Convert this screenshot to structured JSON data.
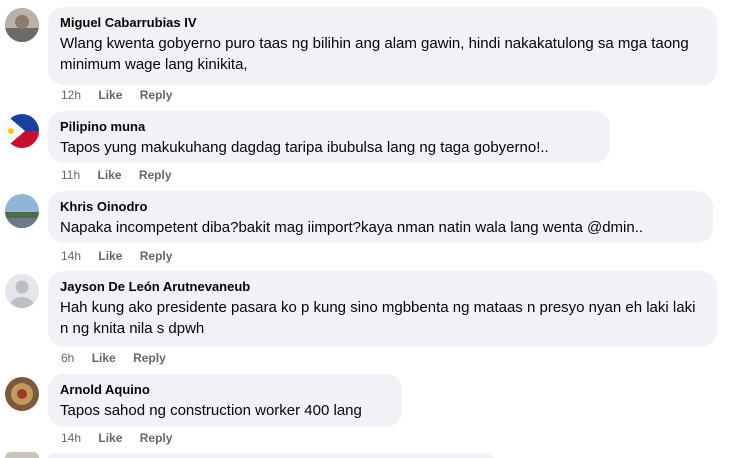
{
  "comments": [
    {
      "author": "Miguel Cabarrubias IV",
      "text": "Wlang kwenta gobyerno puro taas ng bilihin ang alam gawin, hindi nakakatulong sa mga taong minimum wage lang kinikita,",
      "time": "12h",
      "like_label": "Like",
      "reply_label": "Reply"
    },
    {
      "author": "Pilipino muna",
      "text": "Tapos yung makukuhang dagdag taripa ibubulsa lang ng taga gobyerno!..",
      "time": "11h",
      "like_label": "Like",
      "reply_label": "Reply"
    },
    {
      "author": "Khris Oinodro",
      "text": "Napaka incompetent diba?bakit mag iimport?kaya nman natin wala lang wenta @dmin..",
      "time": "14h",
      "like_label": "Like",
      "reply_label": "Reply"
    },
    {
      "author": "Jayson De León Arutnevaneub",
      "text": "Hah kung ako presidente pasara ko p kung sino mgbbenta ng mataas n presyo nyan eh laki laki n ng knita nila s dpwh",
      "time": "6h",
      "like_label": "Like",
      "reply_label": "Reply"
    },
    {
      "author": "Arnold Aquino",
      "text": "Tapos sahod ng construction worker 400 lang",
      "time": "14h",
      "like_label": "Like",
      "reply_label": "Reply"
    }
  ],
  "colors": {
    "bubble_bg": "#f0f2f5",
    "text": "#050505",
    "meta": "#65676b"
  }
}
